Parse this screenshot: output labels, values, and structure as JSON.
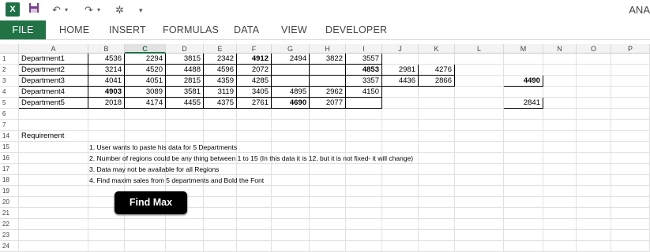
{
  "app": {
    "user": "ANA",
    "logo_text": "X"
  },
  "ribbon": {
    "tabs": [
      "FILE",
      "HOME",
      "INSERT",
      "FORMULAS",
      "DATA",
      "VIEW",
      "DEVELOPER"
    ]
  },
  "columns": [
    "A",
    "B",
    "C",
    "D",
    "E",
    "F",
    "G",
    "H",
    "I",
    "J",
    "K",
    "L",
    "M",
    "N",
    "O",
    "P"
  ],
  "selected_column": "C",
  "rows": [
    {
      "n": "1",
      "cells": {
        "A": "Department1",
        "B": "4536",
        "C": "2294",
        "D": "3815",
        "E": "2342",
        "F": "4912",
        "G": "2494",
        "H": "3822",
        "I": "3557"
      },
      "bold": [
        "F"
      ]
    },
    {
      "n": "2",
      "cells": {
        "A": "Department2",
        "B": "3214",
        "C": "4520",
        "D": "4488",
        "E": "4596",
        "F": "2072",
        "I": "4853",
        "J": "2981",
        "K": "4276"
      },
      "bold": [
        "I"
      ]
    },
    {
      "n": "3",
      "cells": {
        "A": "Department3",
        "B": "4041",
        "C": "4051",
        "D": "2815",
        "E": "4359",
        "F": "4285",
        "I": "3357",
        "J": "4436",
        "K": "2866",
        "M": "4490"
      },
      "bold": [
        "M"
      ]
    },
    {
      "n": "4",
      "cells": {
        "A": "Department4",
        "B": "4903",
        "C": "3089",
        "D": "3581",
        "E": "3119",
        "F": "3405",
        "G": "4895",
        "H": "2962",
        "I": "4150"
      },
      "bold": [
        "B"
      ]
    },
    {
      "n": "5",
      "cells": {
        "A": "Department5",
        "B": "2018",
        "C": "4174",
        "D": "4455",
        "E": "4375",
        "F": "2761",
        "G": "4690",
        "H": "2077",
        "M": "2841"
      },
      "bold": [
        "G"
      ]
    },
    {
      "n": "6",
      "cells": {}
    },
    {
      "n": "7",
      "cells": {}
    },
    {
      "n": "14",
      "cells": {
        "A": "Requirement"
      }
    },
    {
      "n": "15",
      "cells": {
        "C_text": "1. User wants to paste his data for 5 Departments"
      }
    },
    {
      "n": "16",
      "cells": {
        "C_text": "2. Number of regions could be any thing between 1 to 15 (In this data it is 12, but it is not fixed- it will change)"
      }
    },
    {
      "n": "17",
      "cells": {
        "C_text": "3. Data may not be available for all Regions"
      }
    },
    {
      "n": "18",
      "cells": {
        "C_text": "4. Find maxim sales from 5 departments and Bold the Font"
      }
    },
    {
      "n": "19",
      "cells": {}
    },
    {
      "n": "20",
      "cells": {}
    },
    {
      "n": "21",
      "cells": {}
    },
    {
      "n": "22",
      "cells": {}
    },
    {
      "n": "23",
      "cells": {}
    },
    {
      "n": "24",
      "cells": {}
    }
  ],
  "button": {
    "label": "Find Max"
  }
}
